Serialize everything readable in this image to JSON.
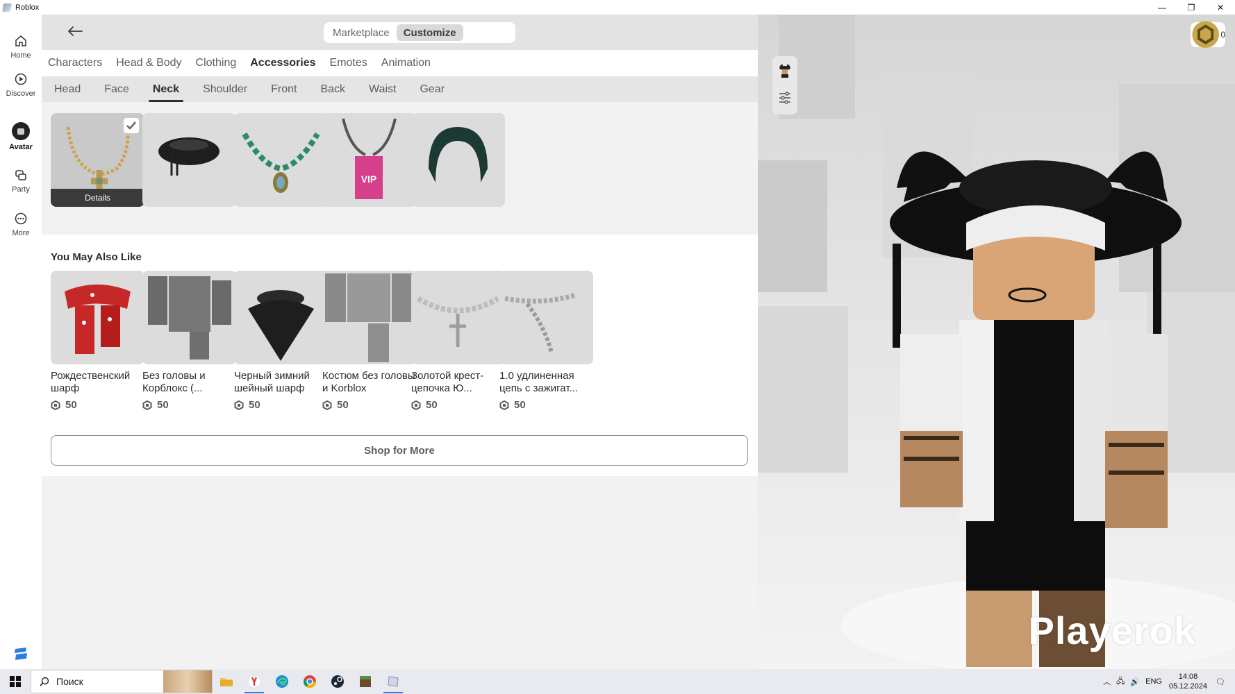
{
  "window": {
    "title": "Roblox"
  },
  "nav": {
    "items": [
      {
        "label": "Home",
        "icon": "home-icon"
      },
      {
        "label": "Discover",
        "icon": "play-circle-icon"
      },
      {
        "label": "Avatar",
        "icon": "avatar-icon"
      },
      {
        "label": "Party",
        "icon": "party-icon"
      },
      {
        "label": "More",
        "icon": "more-icon"
      }
    ]
  },
  "header": {
    "segments": [
      {
        "label": "Marketplace",
        "active": false
      },
      {
        "label": "Customize",
        "active": true
      }
    ]
  },
  "categories": [
    "Characters",
    "Head & Body",
    "Clothing",
    "Accessories",
    "Emotes",
    "Animation"
  ],
  "active_category": "Accessories",
  "subcategories": [
    "Head",
    "Face",
    "Neck",
    "Shoulder",
    "Front",
    "Back",
    "Waist",
    "Gear"
  ],
  "active_subcategory": "Neck",
  "owned": {
    "details_label": "Details",
    "items": [
      {
        "icon": "gold-cross-necklace",
        "selected": true
      },
      {
        "icon": "black-collar",
        "selected": false
      },
      {
        "icon": "jade-bead-necklace",
        "selected": false
      },
      {
        "icon": "vip-lanyard",
        "selected": false
      },
      {
        "icon": "dark-green-scarf",
        "selected": false
      }
    ]
  },
  "recommendations": {
    "title": "You May Also Like",
    "items": [
      {
        "name": "Рождественский шарф",
        "price": "50",
        "icon": "red-christmas-scarf"
      },
      {
        "name": "Без головы и Корблокс (...",
        "price": "50",
        "icon": "headless-korblox"
      },
      {
        "name": "Черный зимний шейный шарф",
        "price": "50",
        "icon": "black-winter-scarf"
      },
      {
        "name": "Костюм без головы и Korblox",
        "price": "50",
        "icon": "headless-korblox-suit"
      },
      {
        "name": "Золотой крест-цепочка Ю...",
        "price": "50",
        "icon": "cross-chain"
      },
      {
        "name": "1.0 удлиненная цепь с зажигат...",
        "price": "50",
        "icon": "long-chain-lighter"
      }
    ],
    "shop_button": "Shop for More"
  },
  "viewport": {
    "robux_balance": "0",
    "watermark": "Playerok"
  },
  "taskbar": {
    "search_placeholder": "Поиск",
    "language": "ENG",
    "time": "14:08",
    "date": "05.12.2024"
  },
  "colors": {
    "accent": "#2b2d2f",
    "panel_bg": "#f2f2f3",
    "taskbar_accent": "#3a78d8"
  }
}
